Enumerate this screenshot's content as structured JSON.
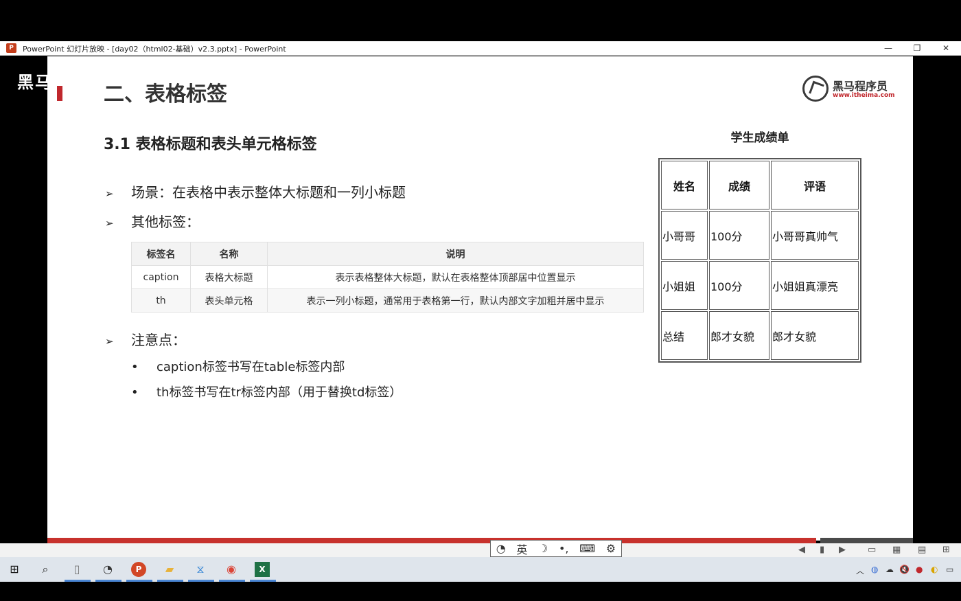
{
  "window": {
    "title": "PowerPoint 幻灯片放映 - [day02（html02-基础）v2.3.pptx] - PowerPoint",
    "app_badge": "P",
    "minimize": "—",
    "restore": "❐",
    "close": "✕"
  },
  "overlay_watermark": "黑马",
  "slide": {
    "title": "二、表格标签",
    "logo": {
      "name": "黑马程序员",
      "url": "www.itheima.com"
    },
    "subtitle": "3.1 表格标题和表头单元格标签",
    "bullets": [
      {
        "arrow": "➢",
        "text": "场景：在表格中表示整体大标题和一列小标题"
      },
      {
        "arrow": "➢",
        "text": "其他标签："
      },
      {
        "arrow": "➢",
        "text": "注意点："
      }
    ],
    "tag_table": {
      "headers": [
        "标签名",
        "名称",
        "说明"
      ],
      "rows": [
        [
          "caption",
          "表格大标题",
          "表示表格整体大标题，默认在表格整体顶部居中位置显示"
        ],
        [
          "th",
          "表头单元格",
          "表示一列小标题，通常用于表格第一行，默认内部文字加粗并居中显示"
        ]
      ]
    },
    "notes": [
      {
        "bullet": "•",
        "text": "caption标签书写在table标签内部"
      },
      {
        "bullet": "•",
        "text": "th标签书写在tr标签内部（用于替换td标签）"
      }
    ],
    "score_table": {
      "caption": "学生成绩单",
      "headers": [
        "姓名",
        "成绩",
        "评语"
      ],
      "rows": [
        [
          "小哥哥",
          "100分",
          "小哥哥真帅气"
        ],
        [
          "小姐姐",
          "100分",
          "小姐姐真漂亮"
        ],
        [
          "总结",
          "郎才女貌",
          "郎才女貌"
        ]
      ]
    }
  },
  "ime_bar": {
    "logo": "◔",
    "lang": "英",
    "moon": "☽",
    "punct": "•,",
    "keyboard": "⌨",
    "settings": "⚙"
  },
  "status_buttons": {
    "prev": "◀",
    "notes": "▮",
    "next": "▶",
    "normal": "▭",
    "sorter": "▦",
    "reading": "▤",
    "slideshow": "⊞"
  },
  "taskbar": {
    "start": "⊞",
    "search": "⌕",
    "file": "▯",
    "app_clock": "◔",
    "powerpoint": "P",
    "explorer": "▰",
    "vscode": "⧖",
    "chrome": "◉",
    "excel": "X"
  },
  "tray": {
    "chevron": "︿",
    "ime_icon": "◍",
    "cloud": "☁",
    "volume": "🔇",
    "app_red": "●",
    "app_yellow": "◐",
    "notify": "▭"
  }
}
